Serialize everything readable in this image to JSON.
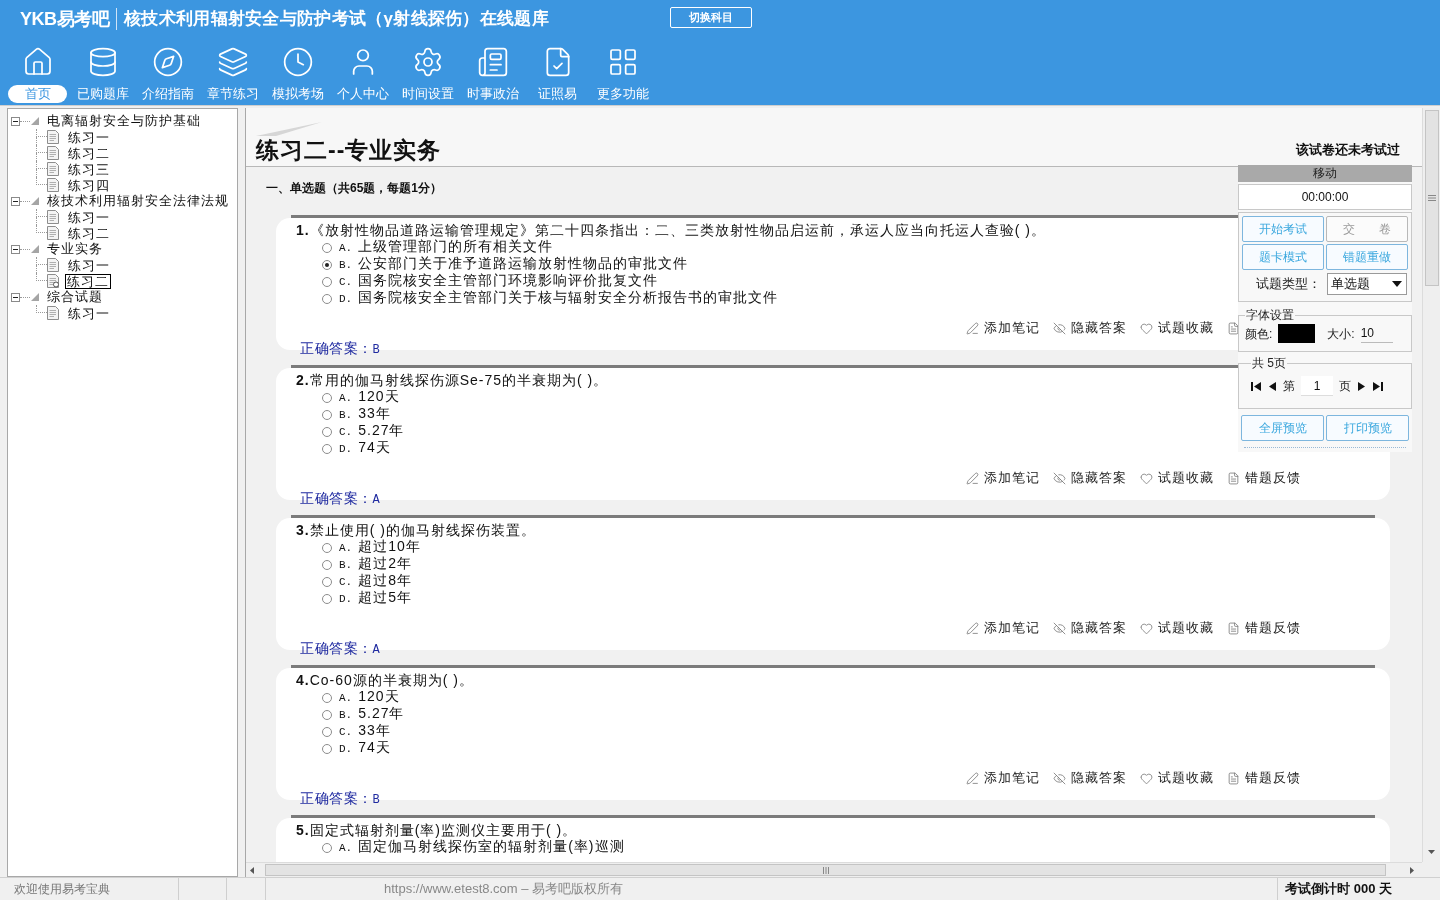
{
  "header": {
    "logo": "YKB易考吧",
    "title": "核技术利用辐射安全与防护考试（γ射线探伤）在线题库",
    "switch_button": "切换科目"
  },
  "toolbar": [
    {
      "label": "首页",
      "selected": true
    },
    {
      "label": "已购题库",
      "selected": false
    },
    {
      "label": "介绍指南",
      "selected": false
    },
    {
      "label": "章节练习",
      "selected": false
    },
    {
      "label": "模拟考场",
      "selected": false
    },
    {
      "label": "个人中心",
      "selected": false
    },
    {
      "label": "时间设置",
      "selected": false
    },
    {
      "label": "时事政治",
      "selected": false
    },
    {
      "label": "证照易",
      "selected": false
    },
    {
      "label": "更多功能",
      "selected": false
    }
  ],
  "sidebar": {
    "tree": [
      {
        "label": "电离辐射安全与防护基础",
        "expanded": true,
        "children": [
          {
            "label": "练习一",
            "selected": false
          },
          {
            "label": "练习二",
            "selected": false
          },
          {
            "label": "练习三",
            "selected": false
          },
          {
            "label": "练习四",
            "selected": false
          }
        ]
      },
      {
        "label": "核技术利用辐射安全法律法规",
        "expanded": true,
        "children": [
          {
            "label": "练习一",
            "selected": false
          },
          {
            "label": "练习二",
            "selected": false
          }
        ]
      },
      {
        "label": "专业实务",
        "expanded": true,
        "children": [
          {
            "label": "练习一",
            "selected": false
          },
          {
            "label": "练习二",
            "selected": true
          }
        ]
      },
      {
        "label": "综合试题",
        "expanded": true,
        "children": [
          {
            "label": "练习一",
            "selected": false
          }
        ]
      }
    ]
  },
  "exam": {
    "title": "练习二--专业实务",
    "status": "该试卷还未考试过",
    "section": "一、单选题（共65题，每题1分）",
    "questions": [
      {
        "number": "1.",
        "text": "《放射性物品道路运输管理规定》第二十四条指出：二、三类放射性物品启运前，承运人应当向托运人查验( )。",
        "options": [
          {
            "letter": "A.",
            "text": "上级管理部门的所有相关文件",
            "selected": false
          },
          {
            "letter": "B.",
            "text": "公安部门关于准予道路运输放射性物品的审批文件",
            "selected": true
          },
          {
            "letter": "C.",
            "text": "国务院核安全主管部门环境影响评价批复文件",
            "selected": false
          },
          {
            "letter": "D.",
            "text": "国务院核安全主管部门关于核与辐射安全分析报告书的审批文件",
            "selected": false
          }
        ],
        "answer_label": "正确答案：",
        "answer": "B",
        "actions": [
          {
            "kind": "note",
            "label": "添加笔记"
          },
          {
            "kind": "hide",
            "label": "隐藏答案"
          },
          {
            "kind": "favorite",
            "label": "试题收藏"
          },
          {
            "kind": "feedback"
          }
        ]
      },
      {
        "number": "2.",
        "text": "常用的伽马射线探伤源Se-75的半衰期为( )。",
        "options": [
          {
            "letter": "A.",
            "text": "120天",
            "selected": false
          },
          {
            "letter": "B.",
            "text": "33年",
            "selected": false
          },
          {
            "letter": "C.",
            "text": "5.27年",
            "selected": false
          },
          {
            "letter": "D.",
            "text": "74天",
            "selected": false
          }
        ],
        "answer_label": "正确答案：",
        "answer": "A",
        "actions": [
          {
            "kind": "note",
            "label": "添加笔记"
          },
          {
            "kind": "hide",
            "label": "隐藏答案"
          },
          {
            "kind": "favorite",
            "label": "试题收藏"
          },
          {
            "kind": "feedback",
            "label": "错题反馈"
          }
        ]
      },
      {
        "number": "3.",
        "text": "禁止使用( )的伽马射线探伤装置。",
        "options": [
          {
            "letter": "A.",
            "text": "超过10年",
            "selected": false
          },
          {
            "letter": "B.",
            "text": "超过2年",
            "selected": false
          },
          {
            "letter": "C.",
            "text": "超过8年",
            "selected": false
          },
          {
            "letter": "D.",
            "text": "超过5年",
            "selected": false
          }
        ],
        "answer_label": "正确答案：",
        "answer": "A",
        "actions": [
          {
            "kind": "note",
            "label": "添加笔记"
          },
          {
            "kind": "hide",
            "label": "隐藏答案"
          },
          {
            "kind": "favorite",
            "label": "试题收藏"
          },
          {
            "kind": "feedback",
            "label": "错题反馈"
          }
        ]
      },
      {
        "number": "4.",
        "text": "Co-60源的半衰期为( )。",
        "options": [
          {
            "letter": "A.",
            "text": "120天",
            "selected": false
          },
          {
            "letter": "B.",
            "text": "5.27年",
            "selected": false
          },
          {
            "letter": "C.",
            "text": "33年",
            "selected": false
          },
          {
            "letter": "D.",
            "text": "74天",
            "selected": false
          }
        ],
        "answer_label": "正确答案：",
        "answer": "B",
        "actions": [
          {
            "kind": "note",
            "label": "添加笔记"
          },
          {
            "kind": "hide",
            "label": "隐藏答案"
          },
          {
            "kind": "favorite",
            "label": "试题收藏"
          },
          {
            "kind": "feedback",
            "label": "错题反馈"
          }
        ]
      },
      {
        "number": "5.",
        "text": "固定式辐射剂量(率)监测仪主要用于( )。",
        "options": [
          {
            "letter": "A.",
            "text": "固定伽马射线探伤室的辐射剂量(率)巡测",
            "selected": false
          }
        ]
      }
    ]
  },
  "float_panel": {
    "handle": "移动",
    "timer": "00:00:00",
    "buttons": [
      {
        "label": "开始考试",
        "disabled": false
      },
      {
        "label": "交　　卷",
        "disabled": true
      },
      {
        "label": "题卡模式",
        "disabled": false
      },
      {
        "label": "错题重做",
        "disabled": false
      }
    ],
    "type_label": "试题类型：",
    "type_value": "单选题",
    "font_legend": "字体设置",
    "color_label": "颜色:",
    "font_color": {
      "color": "#000000"
    },
    "size_label": "大小:",
    "size_value": "10",
    "page_legend": "共 5页",
    "page_prefix": "第",
    "page_value": "1",
    "page_suffix": "页",
    "preview_buttons": [
      "全屏预览",
      "打印预览"
    ]
  },
  "status_bar": {
    "welcome": "欢迎使用易考宝典",
    "copyright": "https://www.etest8.com – 易考吧版权所有",
    "countdown": "考试倒计时 000 天"
  }
}
